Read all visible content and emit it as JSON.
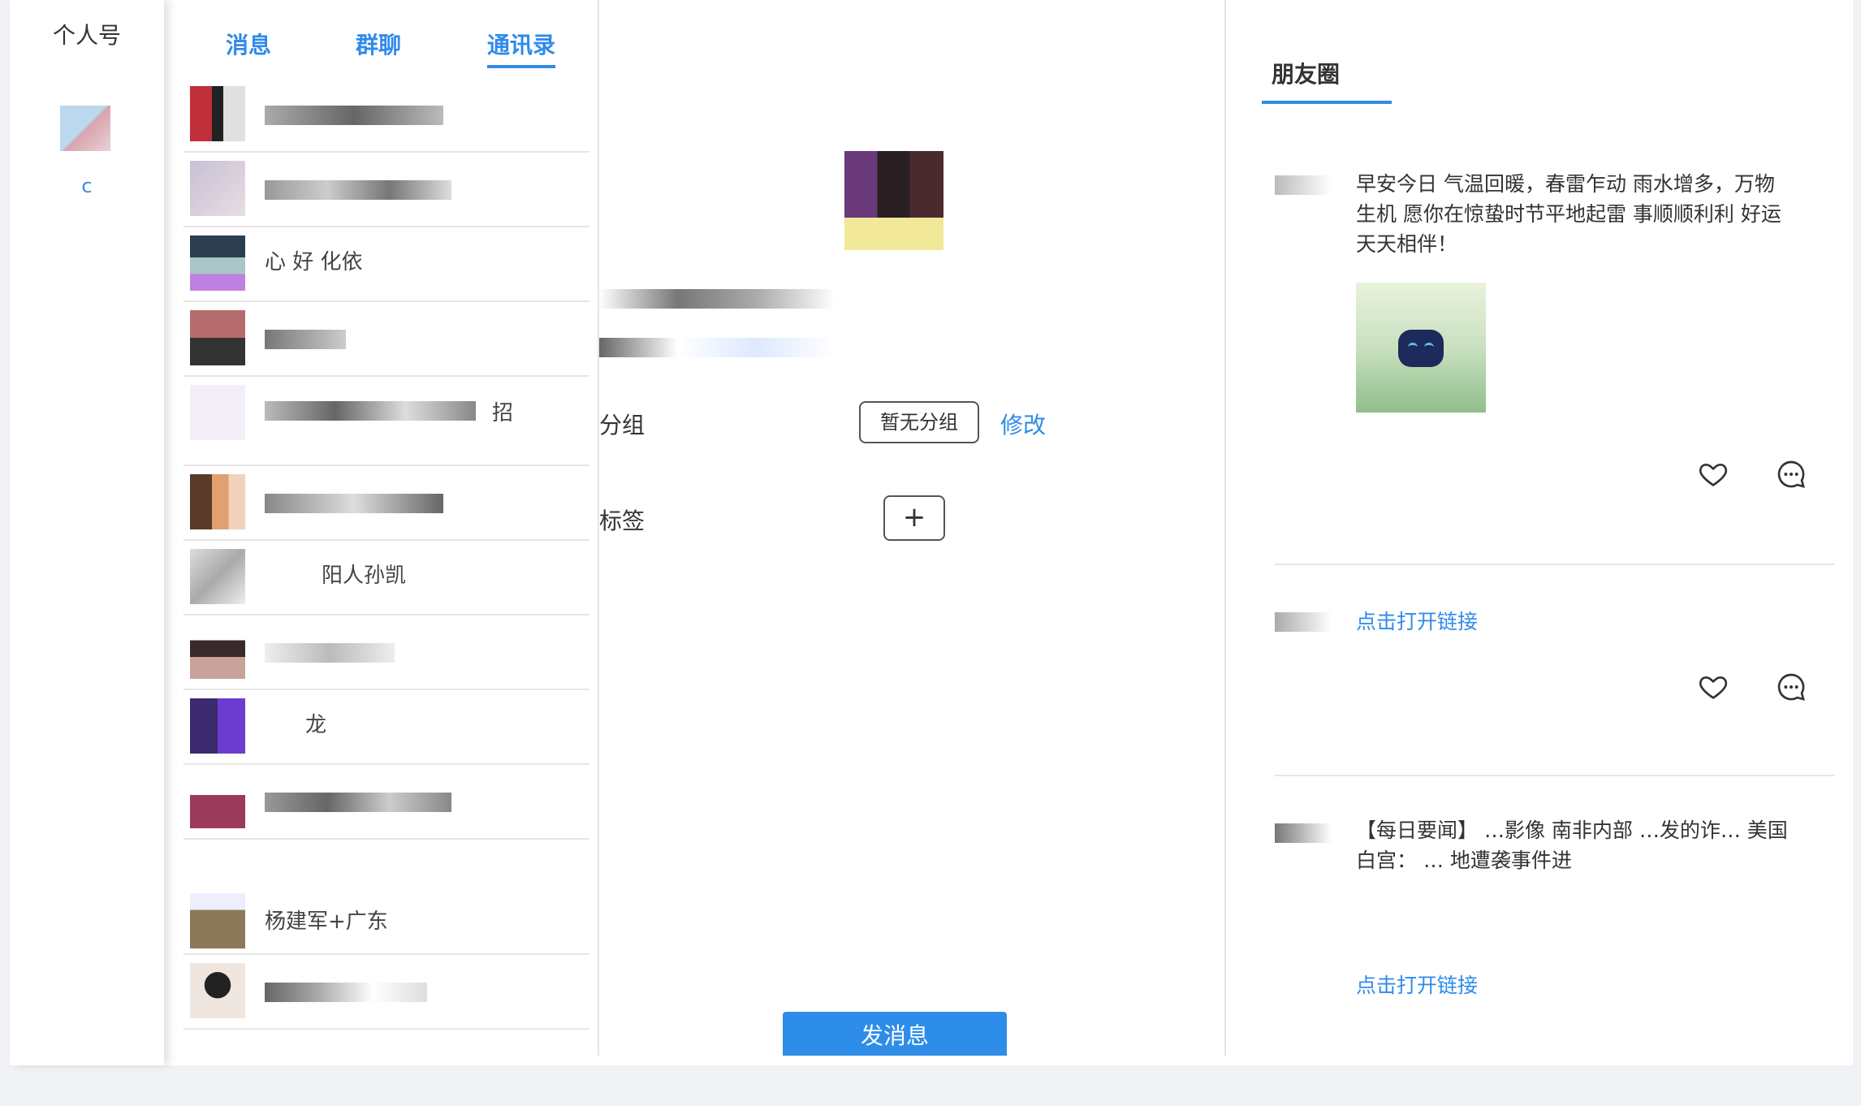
{
  "account": {
    "title": "个人号",
    "label": "c"
  },
  "tabs": [
    {
      "label": "消息",
      "active": false
    },
    {
      "label": "群聊",
      "active": false
    },
    {
      "label": "通讯录",
      "active": true
    }
  ],
  "contacts": [
    {
      "name": ""
    },
    {
      "name": ""
    },
    {
      "name": "心 好 化依"
    },
    {
      "name": ""
    },
    {
      "name": "招"
    },
    {
      "name": ""
    },
    {
      "name": "阳人孙凯"
    },
    {
      "name": ""
    },
    {
      "name": "龙"
    },
    {
      "name": ""
    },
    {
      "name": "杨建军+广东"
    },
    {
      "name": ""
    }
  ],
  "detail": {
    "group_label": "分组",
    "group_value": "暂无分组",
    "modify_label": "修改",
    "tag_label": "标签",
    "tag_add": "+",
    "send_label": "发消息"
  },
  "moments": {
    "tab": "朋友圈",
    "posts": [
      {
        "text": "早安今日 气温回暖，春雷乍动 雨水增多，万物生机 愿你在惊蛰时节平地起雷 事顺顺利利 好运天天相伴！",
        "link": ""
      },
      {
        "text": "",
        "link": "点击打开链接"
      },
      {
        "text": "【每日要闻】 …影像 南非内部 …发的诈… 美国白宫： … 地遭袭事件进",
        "link": "点击打开链接"
      }
    ]
  },
  "colors": {
    "accent": "#2f8bea",
    "send_button": "#2e8de8"
  }
}
